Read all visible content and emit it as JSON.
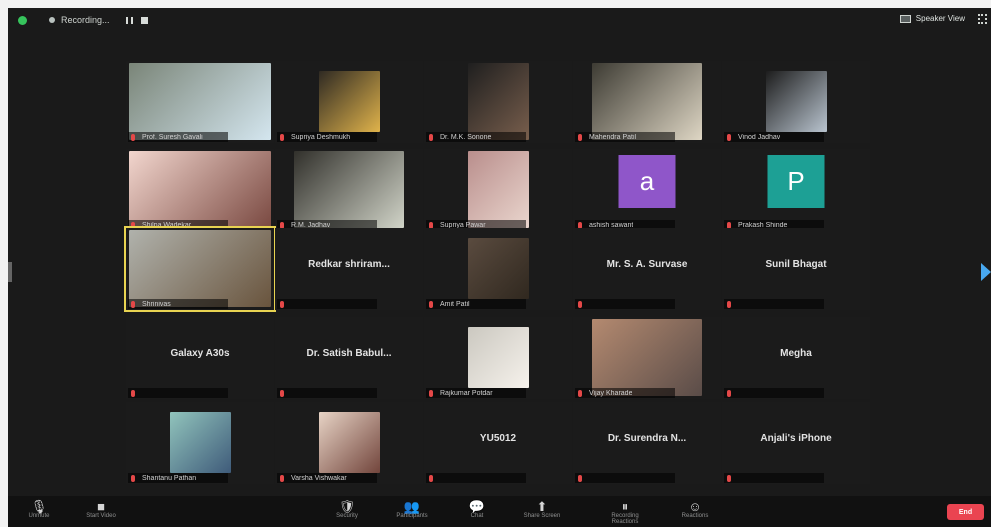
{
  "topbar": {
    "recording": "Recording...",
    "speaker_view": "Speaker View"
  },
  "tiles": [
    {
      "name": "Prof. Suresh Gavali",
      "mode": "video"
    },
    {
      "name": "Supriya Deshmukh",
      "mode": "video"
    },
    {
      "name": "Dr. M.K. Sonone",
      "mode": "video"
    },
    {
      "name": "Mahendra Patil",
      "mode": "video"
    },
    {
      "name": "Vinod Jadhav",
      "mode": "video"
    },
    {
      "name": "Shilpa Wadekar",
      "mode": "video"
    },
    {
      "name": "R.M. Jadhav",
      "mode": "video"
    },
    {
      "name": "Supriya Pawar",
      "mode": "video"
    },
    {
      "name": "ashish sawant",
      "mode": "avatar",
      "avatar": "a",
      "avatar_color": "#8f56c9"
    },
    {
      "name": "Prakash Shinde",
      "mode": "avatar",
      "avatar": "P",
      "avatar_color": "#1da095"
    },
    {
      "name": "Shrinivas",
      "mode": "video",
      "active": true
    },
    {
      "name": "",
      "center": "Redkar shriram...",
      "mode": "name"
    },
    {
      "name": "Amit Patil",
      "mode": "video"
    },
    {
      "name": "",
      "center": "Mr. S. A. Survase",
      "mode": "name"
    },
    {
      "name": "",
      "center": "Sunil Bhagat",
      "mode": "name"
    },
    {
      "name": "",
      "center": "Galaxy A30s",
      "mode": "name"
    },
    {
      "name": "",
      "center": "Dr. Satish Babul...",
      "mode": "name"
    },
    {
      "name": "Rajkumar Potdar",
      "mode": "video"
    },
    {
      "name": "Vijay Kharade",
      "mode": "video"
    },
    {
      "name": "",
      "center": "Megha",
      "mode": "name"
    },
    {
      "name": "Shantanu Pathan",
      "mode": "video"
    },
    {
      "name": "Varsha Vishwakar",
      "mode": "video"
    },
    {
      "name": "",
      "center": "YU5012",
      "mode": "name"
    },
    {
      "name": "",
      "center": "Dr. Surendra N...",
      "mode": "name"
    },
    {
      "name": "",
      "center": "Anjali's iPhone",
      "mode": "name"
    }
  ],
  "controls": [
    {
      "label": "Unmute",
      "icon": "microphone-icon",
      "glyph": "🎙"
    },
    {
      "label": "Start Video",
      "icon": "video-camera-icon",
      "glyph": "■"
    },
    {
      "label": "Security",
      "icon": "shield-icon",
      "glyph": "🛡"
    },
    {
      "label": "Participants",
      "icon": "participants-icon",
      "glyph": "👥"
    },
    {
      "label": "Chat",
      "icon": "chat-icon",
      "glyph": "💬"
    },
    {
      "label": "Share Screen",
      "icon": "share-screen-icon",
      "glyph": "⬆"
    },
    {
      "label": "Recording Reactions",
      "icon": "recording-icon",
      "glyph": "⏸"
    },
    {
      "label": "Reactions",
      "icon": "reaction-icon",
      "glyph": "☺"
    }
  ],
  "end_button": "End",
  "colors": {
    "active_border": "#e8d351",
    "mute_icon": "#e44848",
    "end": "#ea4451"
  }
}
